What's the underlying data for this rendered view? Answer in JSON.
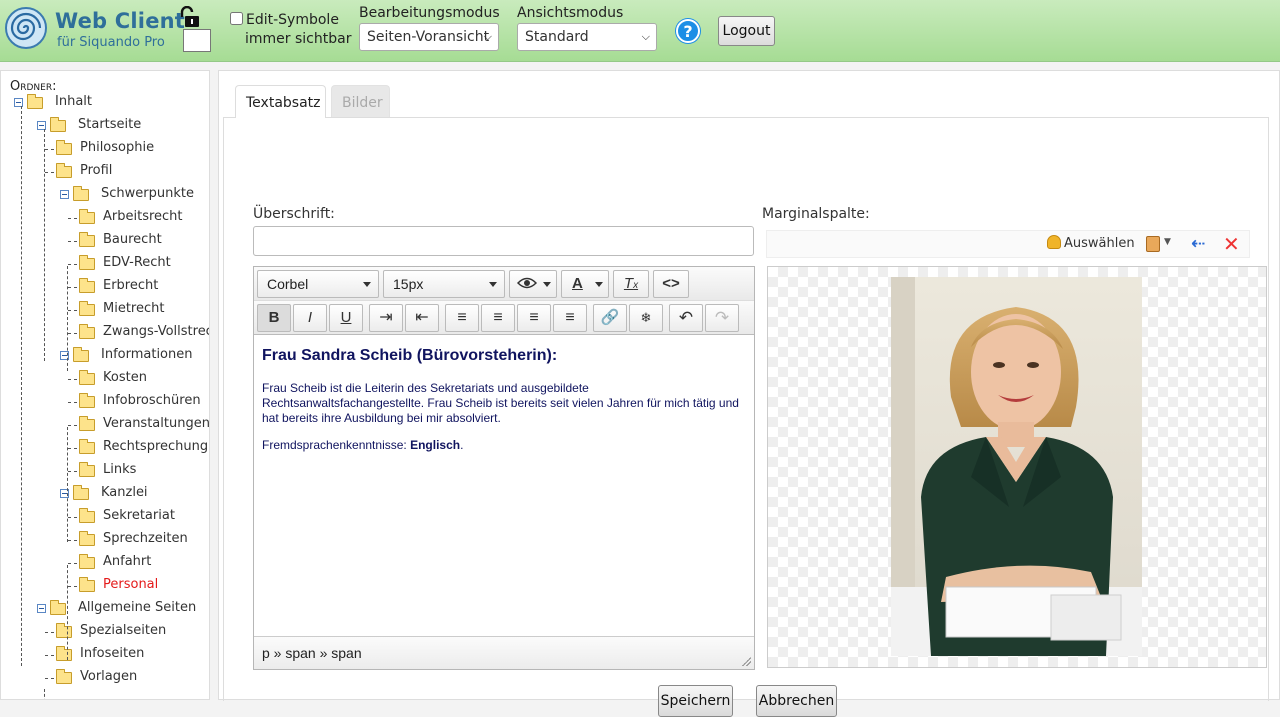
{
  "header": {
    "app_title": "Web Client",
    "app_subtitle": "für Siquando Pro",
    "edit_symbols_line1": "Edit-Symbole",
    "edit_symbols_line2": "immer sichtbar",
    "edit_symbols_checked": false,
    "mode_label": "Bearbeitungsmodus",
    "mode_value": "Seiten-Voransicht",
    "view_label": "Ansichtsmodus",
    "view_value": "Standard",
    "help_glyph": "?",
    "logout_label": "Logout",
    "brand_color": "#2f6f9a",
    "header_color": "#b6e3a6"
  },
  "sidebar": {
    "label": "Ordner:",
    "tree": [
      {
        "label": "Inhalt",
        "depth": 0,
        "expander": true
      },
      {
        "label": "Startseite",
        "depth": 1,
        "expander": true
      },
      {
        "label": "Philosophie",
        "depth": 2,
        "expander": false
      },
      {
        "label": "Profil",
        "depth": 2,
        "expander": false
      },
      {
        "label": "Schwerpunkte",
        "depth": 2,
        "expander": true
      },
      {
        "label": "Arbeitsrecht",
        "depth": 3,
        "expander": false
      },
      {
        "label": "Baurecht",
        "depth": 3,
        "expander": false
      },
      {
        "label": "EDV-Recht",
        "depth": 3,
        "expander": false
      },
      {
        "label": "Erbrecht",
        "depth": 3,
        "expander": false
      },
      {
        "label": "Mietrecht",
        "depth": 3,
        "expander": false
      },
      {
        "label": "Zwangs-Vollstreckung",
        "depth": 3,
        "expander": false
      },
      {
        "label": "Informationen",
        "depth": 2,
        "expander": true
      },
      {
        "label": "Kosten",
        "depth": 3,
        "expander": false
      },
      {
        "label": "Infobroschüren",
        "depth": 3,
        "expander": false
      },
      {
        "label": "Veranstaltungen",
        "depth": 3,
        "expander": false
      },
      {
        "label": "Rechtsprechung",
        "depth": 3,
        "expander": false
      },
      {
        "label": "Links",
        "depth": 3,
        "expander": false
      },
      {
        "label": "Kanzlei",
        "depth": 2,
        "expander": true
      },
      {
        "label": "Sekretariat",
        "depth": 3,
        "expander": false
      },
      {
        "label": "Sprechzeiten",
        "depth": 3,
        "expander": false
      },
      {
        "label": "Anfahrt",
        "depth": 3,
        "expander": false
      },
      {
        "label": "Personal",
        "depth": 3,
        "expander": false,
        "active": true
      },
      {
        "label": "Allgemeine Seiten",
        "depth": 1,
        "expander": true
      },
      {
        "label": "Spezialseiten",
        "depth": 2,
        "expander": false
      },
      {
        "label": "Infoseiten",
        "depth": 2,
        "expander": false
      },
      {
        "label": "Vorlagen",
        "depth": 2,
        "expander": false
      }
    ],
    "active_color": "#e41a1a"
  },
  "main": {
    "tabs": [
      {
        "label": "Textabsatz",
        "active": true
      },
      {
        "label": "Bilder",
        "active": false
      }
    ],
    "heading_label": "Überschrift:",
    "heading_value": "",
    "margin_label": "Marginalspalte:",
    "select_label": "Auswählen",
    "editor": {
      "font_family": "Corbel",
      "font_size": "15px",
      "heading": "Frau Sandra Scheib (Bürovorsteherin):",
      "paragraph1": "Frau Scheib ist die Leiterin des Sekretariats und ausgebildete Rechtsanwaltsfachangestellte. Frau Scheib ist bereits seit vielen Jahren für mich tätig und hat bereits ihre Ausbildung bei mir absolviert.",
      "languages_prefix": "Fremdsprachenkenntnisse: ",
      "languages_value": "Englisch",
      "languages_suffix": ".",
      "statusbar": "p » span » span",
      "text_color": "#10145f"
    },
    "save_label": "Speichern",
    "cancel_label": "Abbrechen"
  }
}
